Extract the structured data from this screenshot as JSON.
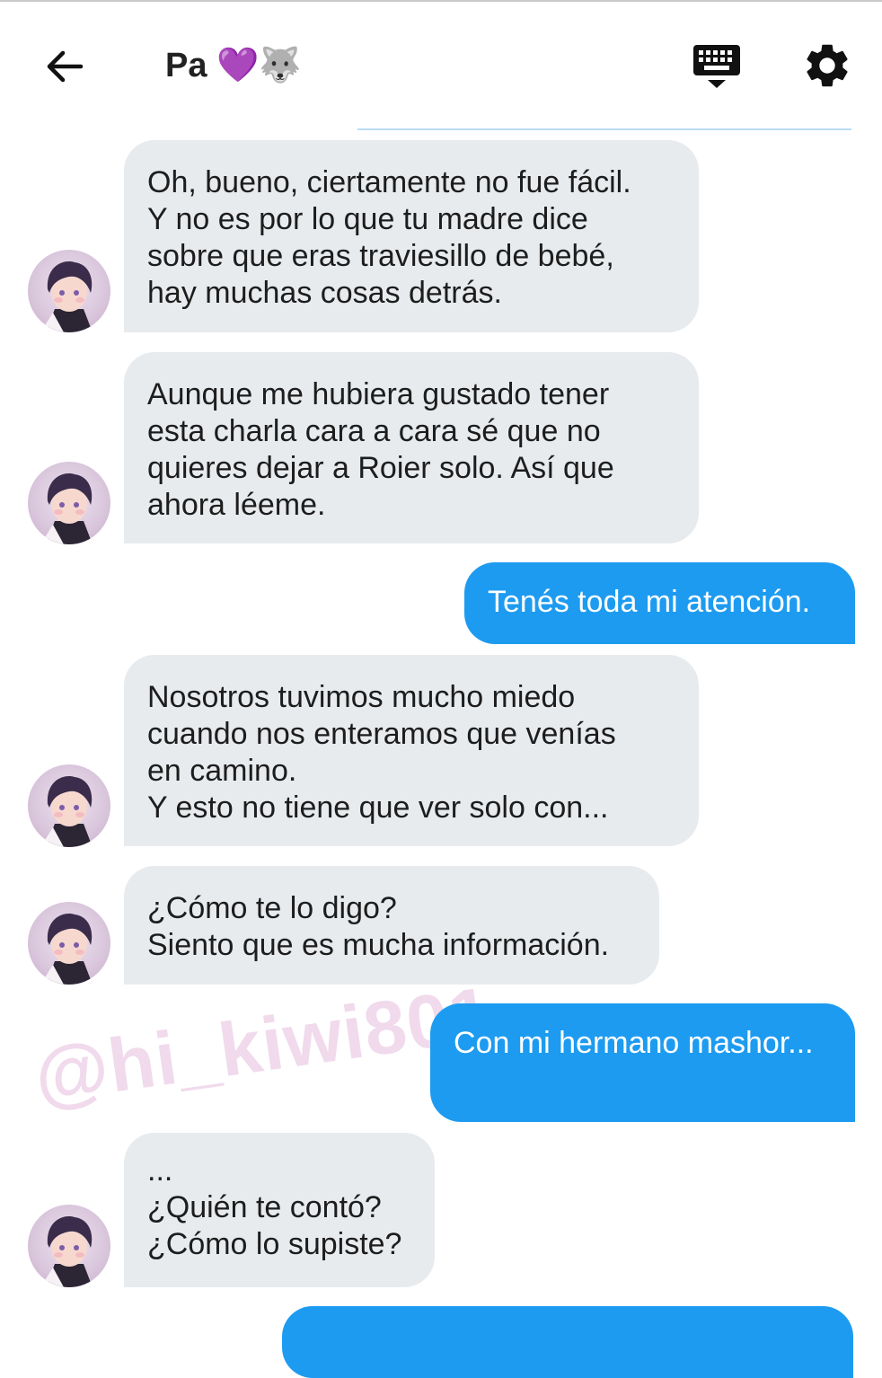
{
  "header": {
    "title": "Pa",
    "title_emoji": "💜🐺",
    "icons": {
      "back": "arrow-left-icon",
      "keyboard": "keyboard-icon",
      "settings": "gear-icon"
    }
  },
  "colors": {
    "incoming_bubble": "#e8ebee",
    "outgoing_bubble": "#1d9bf0",
    "separator": "#b9ddf5",
    "watermark": "#efd6ea"
  },
  "messages": [
    {
      "direction": "in",
      "text": "Oh, bueno, ciertamente no fue fácil.\nY no es por lo que tu madre dice\nsobre que eras traviesillo de bebé,\nhay muchas cosas detrás."
    },
    {
      "direction": "in",
      "text": "Aunque me hubiera gustado tener\nesta charla cara a cara sé que no\nquieres dejar a Roier solo. Así que\nahora léeme."
    },
    {
      "direction": "out",
      "text": "Tenés toda mi atención."
    },
    {
      "direction": "in",
      "text": "Nosotros tuvimos mucho miedo\ncuando nos enteramos que venías\nen camino.\nY esto no tiene que ver solo con..."
    },
    {
      "direction": "in",
      "text": " ¿Cómo te lo digo?\nSiento que es mucha información."
    },
    {
      "direction": "out",
      "text": "Con mi hermano mashor..."
    },
    {
      "direction": "in",
      "text": "...\n¿Quién te contó?\n¿Cómo lo supiste?"
    },
    {
      "direction": "out",
      "text": ""
    }
  ],
  "watermark": "@hi_kiwi801"
}
